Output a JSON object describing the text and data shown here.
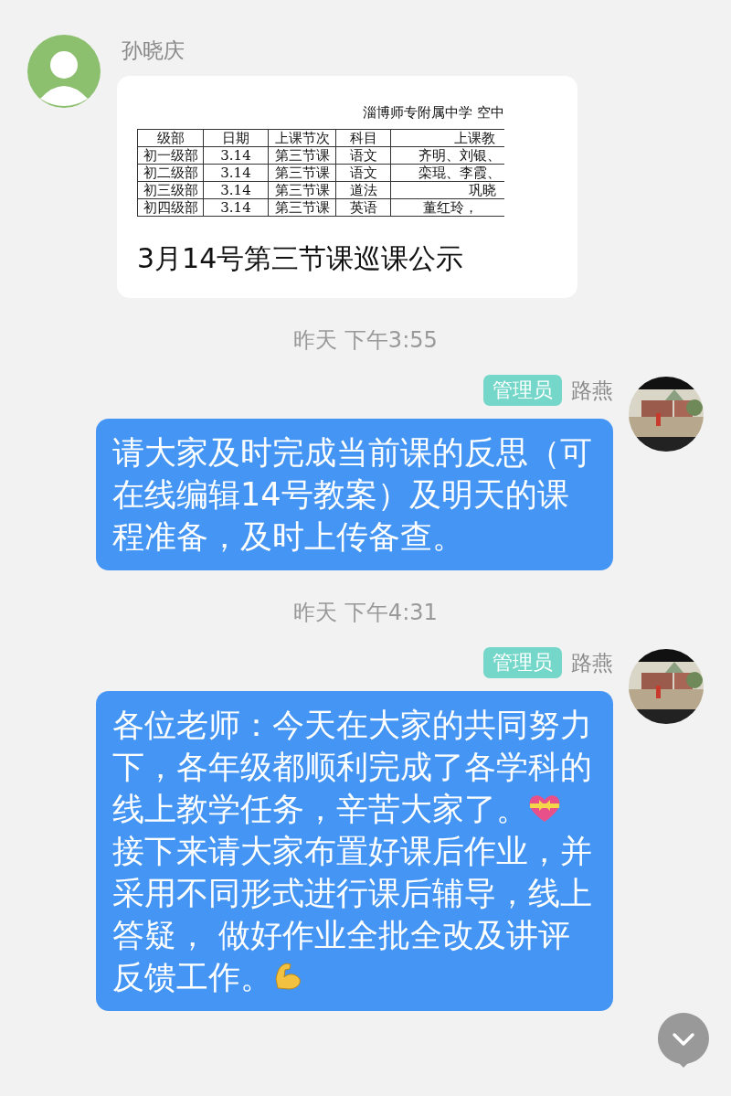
{
  "messages": [
    {
      "kind": "incoming",
      "sender": "孙晓庆",
      "card": {
        "document": {
          "title": "淄博师专附属中学 空中",
          "columns": [
            "级部",
            "日期",
            "上课节次",
            "科目",
            "上课教"
          ],
          "rows": [
            [
              "初一级部",
              "3.14",
              "第三节课",
              "语文",
              "齐明、刘银、"
            ],
            [
              "初二级部",
              "3.14",
              "第三节课",
              "语文",
              "栾琨、李霞、"
            ],
            [
              "初三级部",
              "3.14",
              "第三节课",
              "道法",
              "巩晓"
            ],
            [
              "初四级部",
              "3.14",
              "第三节课",
              "英语",
              "董红玲，"
            ]
          ]
        },
        "caption": "3月14号第三节课巡课公示"
      }
    },
    {
      "kind": "time",
      "text": "昨天 下午3:55"
    },
    {
      "kind": "outgoing",
      "badge": "管理员",
      "sender": "路燕",
      "parts": [
        {
          "kind": "text",
          "text": "请大家及时完成当前课的反思（可在线编辑14号教案）及明天的课程准备，及时上传备查。"
        }
      ]
    },
    {
      "kind": "time",
      "text": "昨天 下午4:31"
    },
    {
      "kind": "outgoing",
      "badge": "管理员",
      "sender": "路燕",
      "parts": [
        {
          "kind": "text",
          "text": "各位老师：今天在大家的共同努力下，各年级都顺利完成了各学科的线上教学任务，辛苦大家了。"
        },
        {
          "kind": "heart"
        },
        {
          "kind": "text",
          "text": "\n接下来请大家布置好课后作业，并采用不同形式进行课后辅导，线上答疑， 做好作业全批全改及讲评反馈工作。"
        },
        {
          "kind": "arm"
        }
      ]
    }
  ]
}
